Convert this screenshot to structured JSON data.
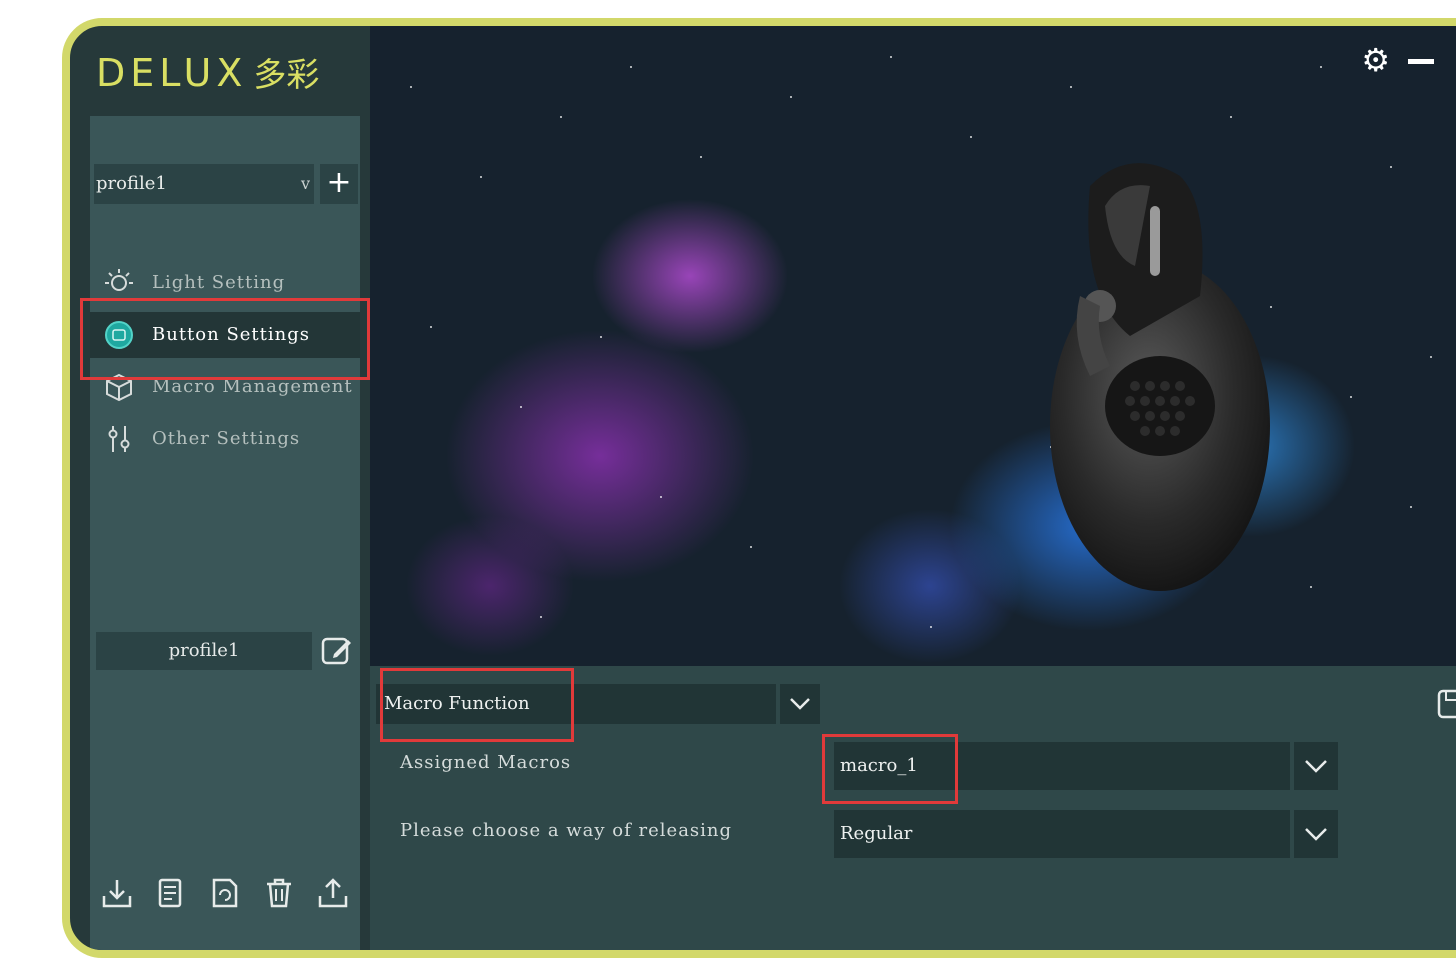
{
  "app": {
    "logo_text": "DELUX",
    "logo_cn": "多彩"
  },
  "sidebar": {
    "profile_select_value": "profile1",
    "add_label": "+",
    "menu": [
      {
        "label": "Light Setting",
        "icon": "light-bulb-icon"
      },
      {
        "label": "Button Settings",
        "icon": "button-icon"
      },
      {
        "label": "Macro Management",
        "icon": "macro-cube-icon"
      },
      {
        "label": "Other Settings",
        "icon": "sliders-icon"
      }
    ],
    "profile_name": "profile1",
    "bottom_icons": [
      "import-icon",
      "document-icon",
      "refresh-file-icon",
      "trash-icon",
      "export-icon"
    ]
  },
  "panel": {
    "function_value": "Macro Function",
    "assigned_label": "Assigned Macros",
    "assigned_value": "macro_1",
    "release_label": "Please choose a way of releasing",
    "release_value": "Regular"
  },
  "colors": {
    "frame": "#d2d86a",
    "highlight": "#e13a3a",
    "background": "#26393a"
  }
}
